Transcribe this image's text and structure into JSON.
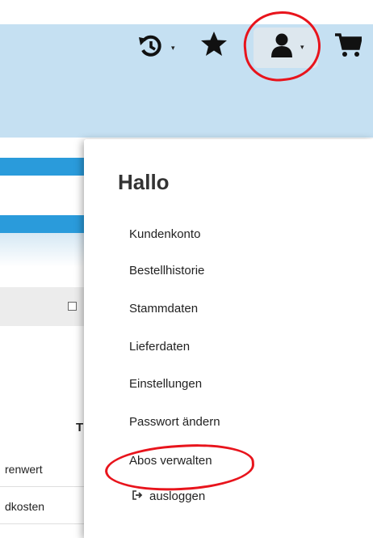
{
  "header": {
    "icons": [
      {
        "name": "history-icon",
        "glyph": "↺"
      },
      {
        "name": "star-icon",
        "glyph": "★"
      },
      {
        "name": "user-icon",
        "glyph": "user"
      },
      {
        "name": "cart-icon",
        "glyph": "cart"
      }
    ],
    "caret": "▾",
    "highlight_color": "#e8141c",
    "bar_color": "#c5e0f2"
  },
  "background": {
    "table_header_fragment": "T",
    "rows": [
      "renwert",
      "dkosten"
    ]
  },
  "dropdown": {
    "greeting": "Hallo",
    "items": [
      {
        "label": "Kundenkonto"
      },
      {
        "label": "Bestellhistorie"
      },
      {
        "label": "Stammdaten"
      },
      {
        "label": "Lieferdaten"
      },
      {
        "label": "Einstellungen"
      },
      {
        "label": "Passwort ändern"
      },
      {
        "label": "Abos verwalten"
      }
    ],
    "logout": {
      "label": "ausloggen",
      "icon": "sign-out-icon"
    }
  }
}
